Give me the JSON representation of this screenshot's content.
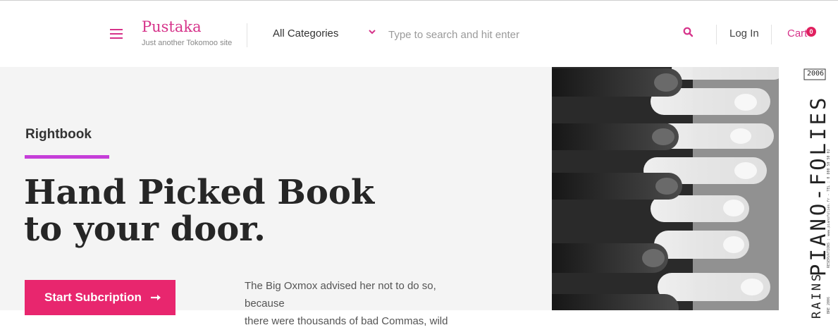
{
  "header": {
    "menu_icon": "hamburger-menu-icon",
    "site_title": "Pustaka",
    "tagline": "Just another Tokomoo site",
    "category_select": {
      "selected": "All Categories",
      "icon": "chevron-down-icon"
    },
    "search": {
      "placeholder": "Type to search and hit enter",
      "value": "",
      "icon": "search-icon"
    },
    "login_label": "Log In",
    "cart": {
      "label": "Cart",
      "count": "0"
    }
  },
  "hero": {
    "eyebrow": "Rightbook",
    "title_lines": [
      "Hand Picked Book",
      "to your door."
    ],
    "cta_label": "Start Subcription",
    "cta_icon": "arrow-right-icon",
    "body_lines": [
      "The Big Oxmox advised her not to do so, because",
      "there were thousands of bad Commas, wild"
    ]
  },
  "poster": {
    "year": "2006",
    "title": "PIANO-FOLIES",
    "side_text": "RAINS",
    "small_print": "RESERVATIONS : www.pianofolies.fr - TEL : 0 800 50 50 02",
    "small_print_2": "BRE 2006"
  },
  "colors": {
    "accent": "#d6338a",
    "cta": "#e8266e",
    "eyebrow_bar": "#c53ed8",
    "badge": "#e0205f",
    "hero_bg": "#f4f4f4"
  }
}
